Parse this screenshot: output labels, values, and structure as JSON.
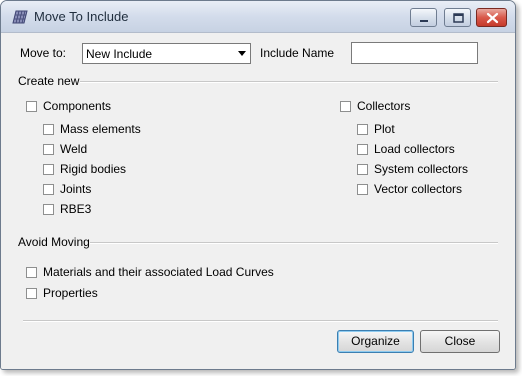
{
  "window": {
    "title": "Move To Include"
  },
  "move_to": {
    "label": "Move to:",
    "selected": "New Include"
  },
  "include_name": {
    "label": "Include Name",
    "value": ""
  },
  "create_new": {
    "heading": "Create new",
    "components": {
      "label": "Components",
      "items": [
        "Mass elements",
        "Weld",
        "Rigid bodies",
        "Joints",
        "RBE3"
      ]
    },
    "collectors": {
      "label": "Collectors",
      "items": [
        "Plot",
        "Load collectors",
        "System collectors",
        "Vector collectors"
      ]
    }
  },
  "avoid_moving": {
    "heading": "Avoid Moving",
    "items": [
      "Materials and their associated Load Curves",
      "Properties"
    ]
  },
  "buttons": {
    "organize": "Organize",
    "close": "Close"
  },
  "colors": {
    "titlebar": "#d3dceb",
    "close_button": "#c53a2a",
    "dialog_bg": "#f0f0f0"
  }
}
